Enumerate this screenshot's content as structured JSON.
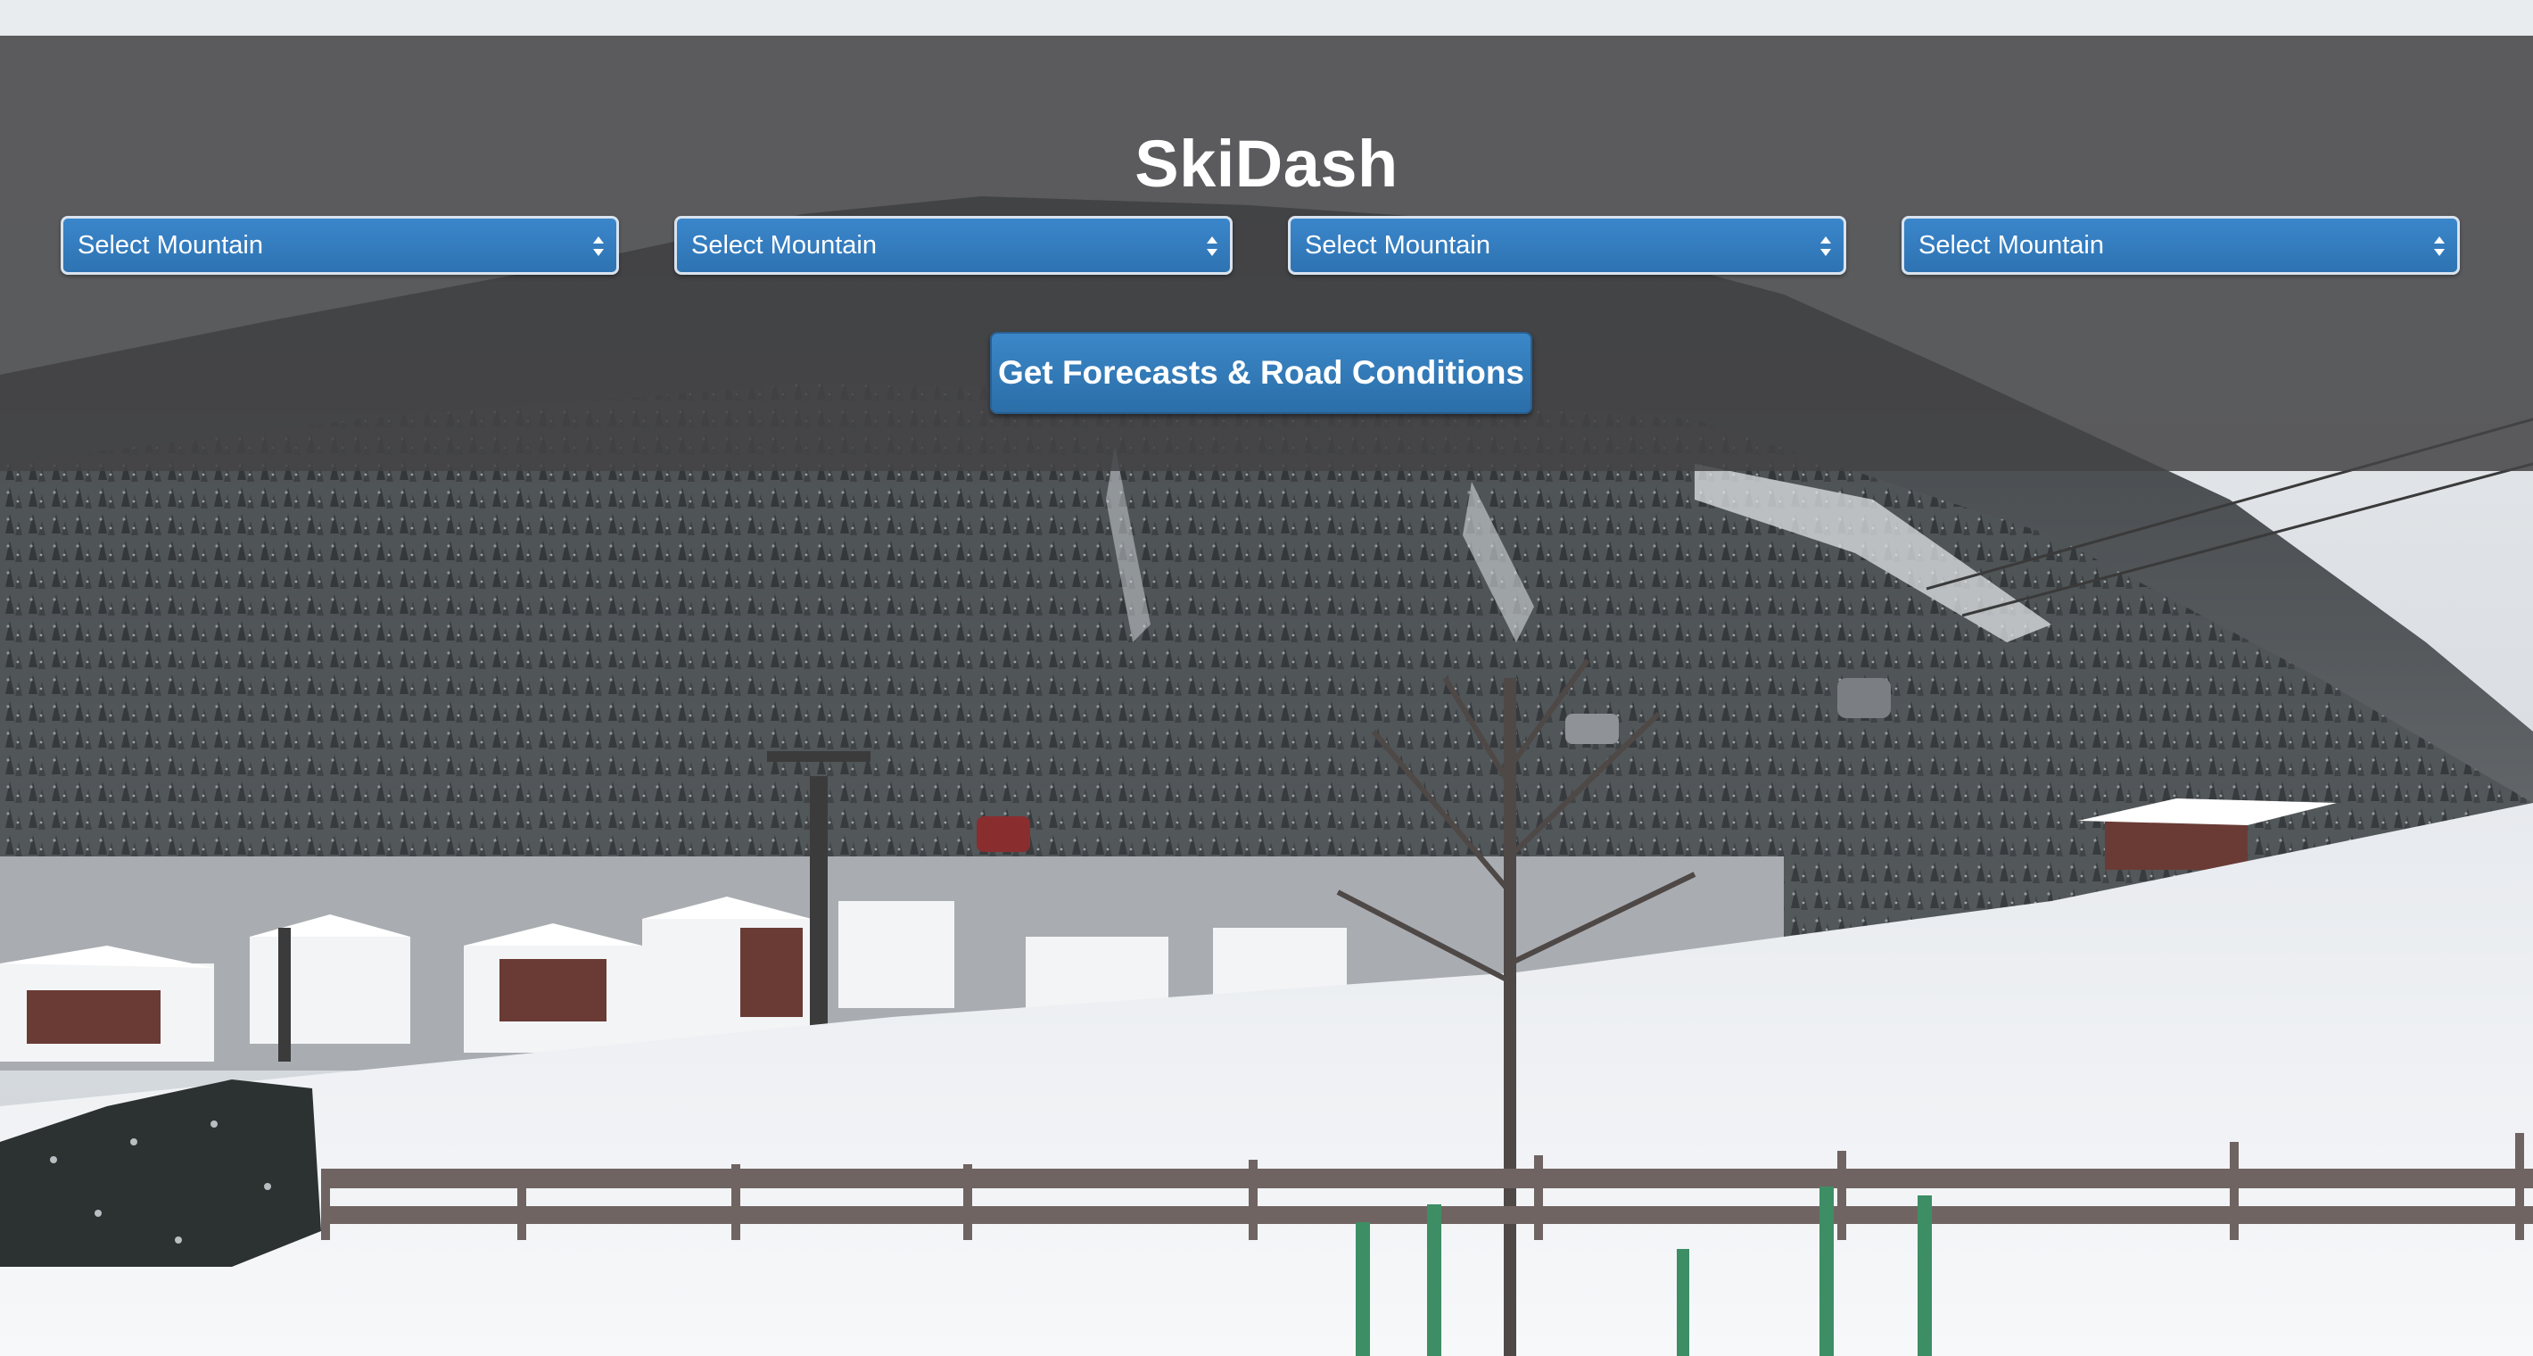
{
  "app": {
    "title": "SkiDash"
  },
  "selectors": [
    {
      "selected": "Select Mountain"
    },
    {
      "selected": "Select Mountain"
    },
    {
      "selected": "Select Mountain"
    },
    {
      "selected": "Select Mountain"
    }
  ],
  "actions": {
    "submit_label": "Get Forecasts & Road Conditions"
  },
  "icons": {
    "select_arrow": "up-down-chevron-icon"
  },
  "colors": {
    "accent": "#337ab7",
    "overlay": "#444446",
    "snow": "#f4f6f8"
  }
}
